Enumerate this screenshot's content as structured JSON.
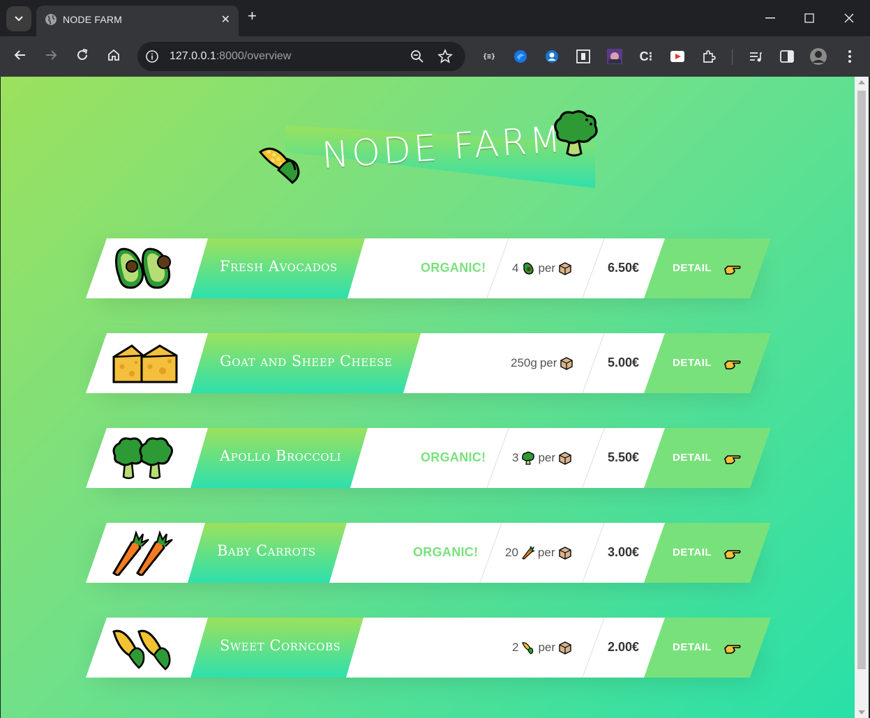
{
  "browser": {
    "tab_title": "NODE FARM",
    "url_host": "127.0.0.1",
    "url_rest": ":8000/overview"
  },
  "page": {
    "title_first": "NODE",
    "title_second": "FARM"
  },
  "products": [
    {
      "name": "Fresh Avocados",
      "organic": "ORGANIC!",
      "qty_prefix": "4",
      "per": "per",
      "price": "6.50€",
      "detail": "DETAIL",
      "emoji": "avocado"
    },
    {
      "name": "Goat and Sheep Cheese",
      "organic": "",
      "qty_prefix": "250g",
      "per": "per",
      "price": "5.00€",
      "detail": "DETAIL",
      "emoji": "cheese"
    },
    {
      "name": "Apollo Broccoli",
      "organic": "ORGANIC!",
      "qty_prefix": "3",
      "per": "per",
      "price": "5.50€",
      "detail": "DETAIL",
      "emoji": "broccoli"
    },
    {
      "name": "Baby Carrots",
      "organic": "ORGANIC!",
      "qty_prefix": "20",
      "per": "per",
      "price": "3.00€",
      "detail": "DETAIL",
      "emoji": "carrot"
    },
    {
      "name": "Sweet Corncobs",
      "organic": "",
      "qty_prefix": "2",
      "per": "per",
      "price": "2.00€",
      "detail": "DETAIL",
      "emoji": "corn"
    }
  ],
  "colors": {
    "accent_green": "#79e17b",
    "gradient_top": "#9be15d",
    "gradient_bottom": "#2ee0ad"
  }
}
